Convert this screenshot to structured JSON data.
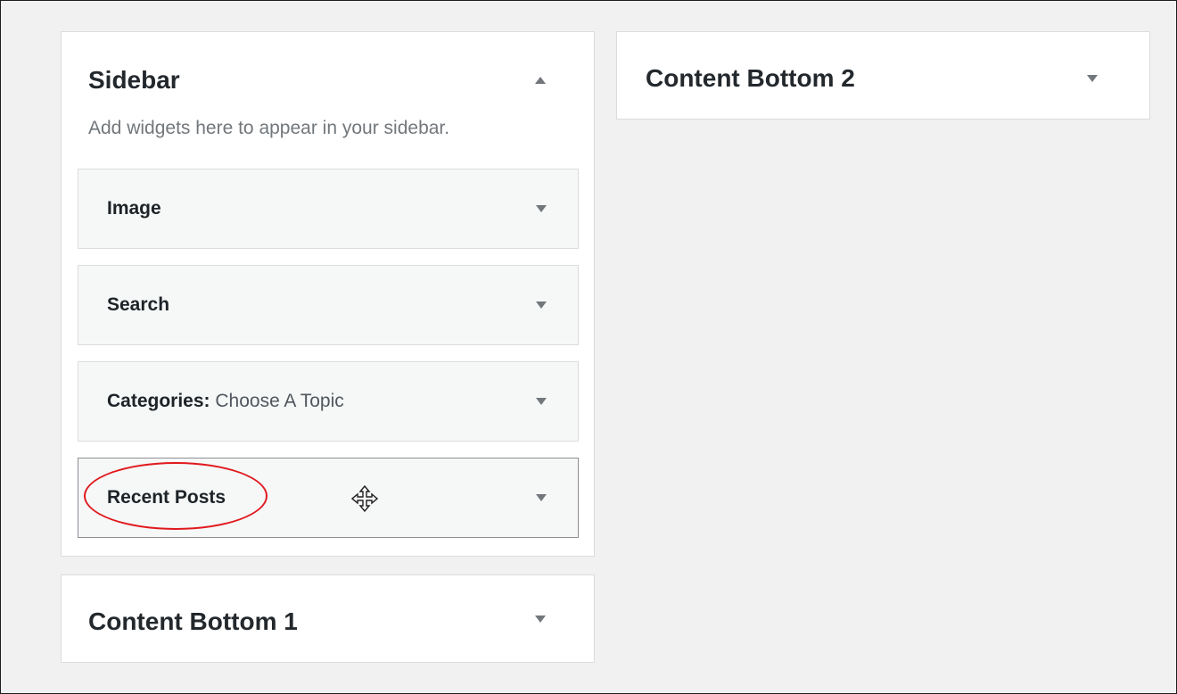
{
  "sidebar_area": {
    "title": "Sidebar",
    "description": "Add widgets here to appear in your sidebar.",
    "widgets": [
      {
        "label": "Image",
        "subtitle": ""
      },
      {
        "label": "Search",
        "subtitle": ""
      },
      {
        "label": "Categories:",
        "subtitle": "Choose A Topic"
      },
      {
        "label": "Recent Posts",
        "subtitle": ""
      }
    ]
  },
  "content_bottom_1": {
    "title": "Content Bottom 1"
  },
  "content_bottom_2": {
    "title": "Content Bottom 2"
  },
  "icons": {
    "expand": "triangle-down-icon",
    "collapse": "triangle-up-icon",
    "drag": "move-cursor-icon"
  },
  "colors": {
    "background": "#f1f1f1",
    "panel": "#ffffff",
    "widget": "#f6f7f7",
    "annotation": "#e0191e"
  }
}
